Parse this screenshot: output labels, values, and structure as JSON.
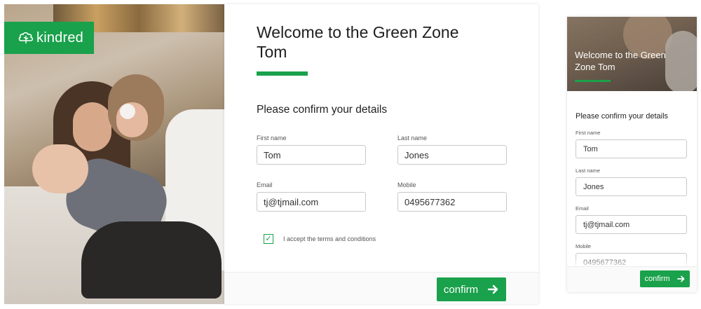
{
  "brand": {
    "name": "kindred",
    "accent_color": "#1aa14b",
    "logo_icon": "tree-icon"
  },
  "welcome": {
    "line1": "Welcome to the Green Zone",
    "line2": "Tom"
  },
  "mobile_welcome": {
    "line1": "Welcome to the Green",
    "line2": "Zone Tom"
  },
  "form": {
    "heading": "Please confirm your details",
    "first_name": {
      "label": "First name",
      "value": "Tom"
    },
    "last_name": {
      "label": "Last name",
      "value": "Jones"
    },
    "email": {
      "label": "Email",
      "value": "tj@tjmail.com"
    },
    "mobile": {
      "label": "Mobile",
      "value": "0495677362"
    },
    "terms": {
      "label": "I accept the terms and conditions",
      "checked": true
    },
    "confirm_label": "confirm",
    "confirm_icon": "arrow-right-icon"
  }
}
